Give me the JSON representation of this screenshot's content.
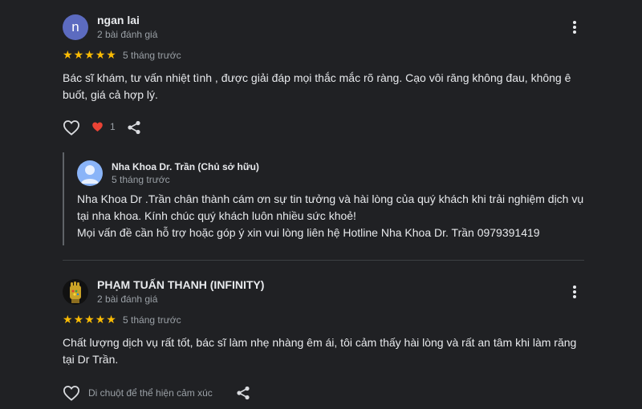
{
  "reviews": [
    {
      "avatar_letter": "n",
      "name": "ngan lai",
      "review_count": "2 bài đánh giá",
      "stars": [
        "★",
        "★",
        "★",
        "★",
        "★"
      ],
      "time": "5 tháng trước",
      "text_line1": "Bác sĩ khám, tư vấn nhiệt tình , được giải đáp mọi thắc mắc rõ ràng. Cạo vôi răng không đau, không ê",
      "text_line2": "buốt, giá cả hợp lý.",
      "like_count": "1",
      "owner_reply": {
        "name": "Nha Khoa Dr. Trần (Chủ sở hữu)",
        "time": "5 tháng trước",
        "line1": "Nha Khoa Dr .Trần chân thành cám ơn sự tin tưởng và hài lòng của quý khách khi trải nghiệm dịch vụ",
        "line2": "tại nha khoa. Kính chúc quý khách luôn nhiều sức khoẻ!",
        "line3": "Mọi vấn đề cần hỗ trợ hoặc góp ý xin vui lòng liên hệ Hotline Nha Khoa Dr. Trần 0979391419"
      }
    },
    {
      "name": "PHẠM TUẤN THANH (INFINITY)",
      "review_count": "2 bài đánh giá",
      "stars": [
        "★",
        "★",
        "★",
        "★",
        "★"
      ],
      "time": "5 tháng trước",
      "text_line1": "Chất lượng dịch vụ rất tốt, bác sĩ làm nhẹ nhàng êm ái, tôi cảm thấy hài lòng và rất an tâm khi làm răng",
      "text_line2": "tại Dr Trần.",
      "reaction_hint": "Di chuột để thể hiện cảm xúc"
    }
  ],
  "colors": {
    "background": "#202124",
    "star": "#fbbc04",
    "heart_active": "#ea4335",
    "secondary_text": "#9aa0a6"
  },
  "icons": [
    "heart-outline-icon",
    "heart-filled-icon",
    "share-icon",
    "more-vert-icon"
  ]
}
